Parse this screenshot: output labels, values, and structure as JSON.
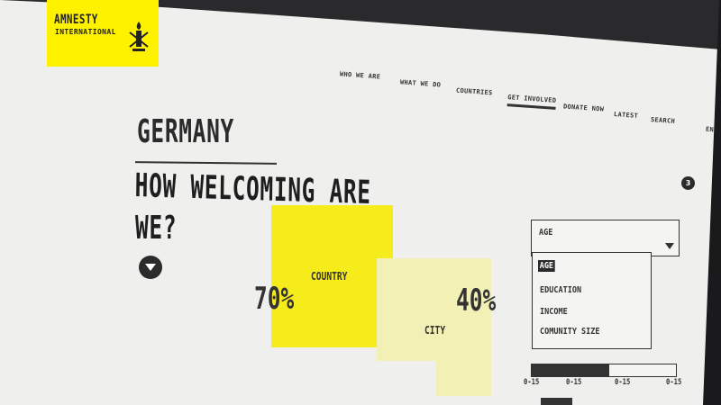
{
  "logo": {
    "line1": "AMNESTY",
    "line2": "INTERNATIONAL"
  },
  "nav": {
    "items": [
      {
        "label": "WHO WE ARE"
      },
      {
        "label": "WHAT WE DO"
      },
      {
        "label": "COUNTRIES"
      },
      {
        "label": "GET INVOLVED",
        "active": true
      },
      {
        "label": "DONATE NOW"
      },
      {
        "label": "LATEST"
      },
      {
        "label": "SEARCH"
      },
      {
        "label": "EN"
      }
    ]
  },
  "main": {
    "title_line1": "GERMANY",
    "title_line2": "HOW WELCOMING ARE",
    "title_line3": "WE?",
    "info_badge": "3"
  },
  "stats": {
    "country": {
      "label": "COUNTRY",
      "value": "70%"
    },
    "city": {
      "label": "CITY",
      "value": "40%"
    }
  },
  "filter": {
    "selected": "AGE",
    "options": [
      "AGE",
      "EDUCATION",
      "INCOME",
      "COMUNITY SIZE"
    ]
  },
  "range": {
    "fill_fraction": 0.54,
    "ticks": [
      "0-15",
      "0-15",
      "0-15",
      "0-15"
    ]
  },
  "colors": {
    "brand_yellow": "#f6ec1c",
    "light_yellow": "#f2f0b4",
    "text_dark": "#2a2a2a"
  }
}
